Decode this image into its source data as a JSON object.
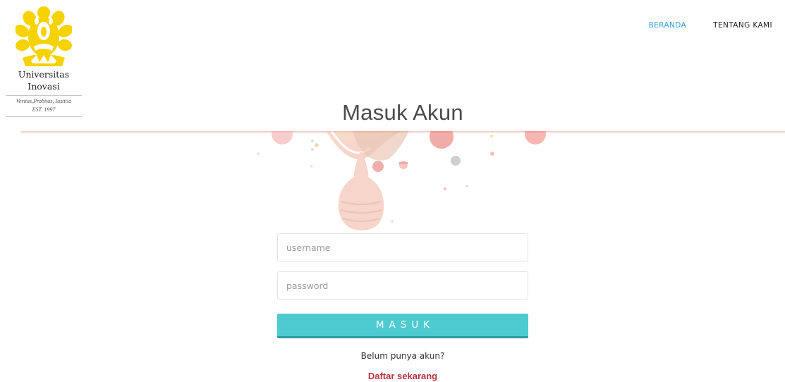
{
  "logo": {
    "name_line1": "Universitas",
    "name_line2": "Inovasi",
    "motto": "Veritas,Probitas, Iustitia",
    "established": "EST. 1997",
    "emblem_icon": "makara-emblem-icon",
    "emblem_color": "#f5d200"
  },
  "nav": {
    "items": [
      {
        "label": "BERANDA",
        "active": true
      },
      {
        "label": "TENTANG KAMI",
        "active": false
      }
    ],
    "active_color": "#3aa0d8"
  },
  "page": {
    "title": "Masuk Akun"
  },
  "form": {
    "username_placeholder": "username",
    "password_placeholder": "password",
    "submit_label": "MASUK",
    "submit_color": "#4ecbd1"
  },
  "signup": {
    "prompt": "Belum punya akun?",
    "link": "Daftar sekarang",
    "link_color": "#b9333e"
  }
}
